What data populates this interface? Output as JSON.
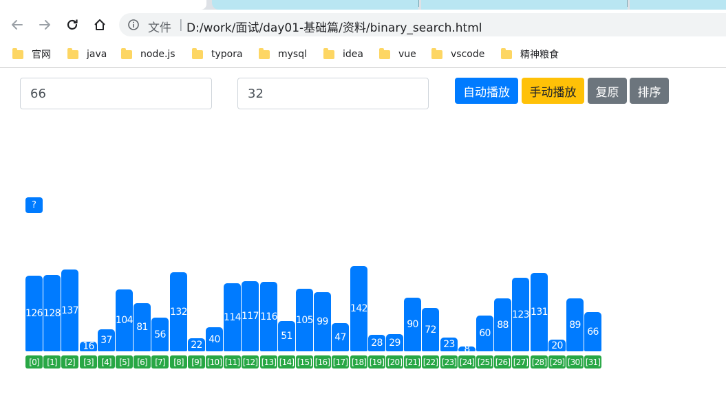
{
  "browser": {
    "url_scheme": "文件",
    "url_separator": "|",
    "url": "D:/work/面试/day01-基础篇/资料/binary_search.html",
    "bookmarks": [
      "官网",
      "java",
      "node.js",
      "typora",
      "mysql",
      "idea",
      "vue",
      "vscode",
      "精神粮食"
    ]
  },
  "controls": {
    "target_value": "66",
    "count_value": "32",
    "buttons": {
      "auto_play": "自动播放",
      "manual_play": "手动播放",
      "reset": "复原",
      "sort": "排序"
    },
    "colors": {
      "primary": "#007bff",
      "warning": "#ffc107",
      "secondary": "#6c757d",
      "success": "#28a745"
    }
  },
  "pointer": {
    "label": "?"
  },
  "array": {
    "values": [
      126,
      128,
      137,
      16,
      37,
      104,
      81,
      56,
      132,
      22,
      40,
      114,
      117,
      116,
      51,
      105,
      99,
      47,
      142,
      28,
      29,
      90,
      72,
      23,
      8,
      60,
      88,
      123,
      131,
      20,
      89,
      66
    ],
    "index_labels": [
      "[0]",
      "[1]",
      "[2]",
      "[3]",
      "[4]",
      "[5]",
      "[6]",
      "[7]",
      "[8]",
      "[9]",
      "[10]",
      "[11]",
      "[12]",
      "[13]",
      "[14]",
      "[15]",
      "[16]",
      "[17]",
      "[18]",
      "[19]",
      "[20]",
      "[21]",
      "[22]",
      "[23]",
      "[24]",
      "[25]",
      "[26]",
      "[27]",
      "[28]",
      "[29]",
      "[30]",
      "[31]"
    ]
  }
}
